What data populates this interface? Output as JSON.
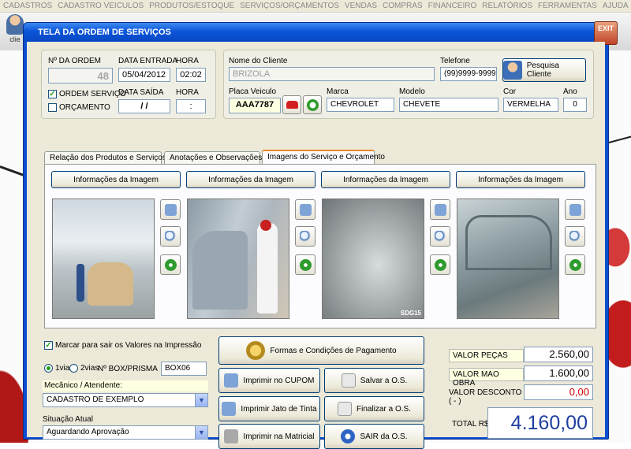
{
  "menu": [
    "CADASTROS",
    "CADASTRO VEICULOS",
    "PRODUTOS/ESTOQUE",
    "SERVIÇOS/ORÇAMENTOS",
    "VENDAS",
    "COMPRAS",
    "FINANCEIRO",
    "RELATÓRIOS",
    "FERRAMENTAS",
    "AJUDA"
  ],
  "toolbar": {
    "left_label": "clie"
  },
  "window": {
    "title": "TELA DA ORDEM DE SERVIÇOS",
    "exit_label": "EXIT"
  },
  "order": {
    "num_label": "Nº DA ORDEM",
    "num_value": "48",
    "entry_label": "DATA ENTRADA",
    "entry_date": "05/04/2012",
    "hour_label": "HORA",
    "entry_hour": "02:02",
    "exit_label": "DATA SAÍDA",
    "exit_date": " / / ",
    "exit_hour_label": "HORA",
    "exit_hour": ":",
    "chk_os": "ORDEM SERVIÇO",
    "chk_orc": "ORÇAMENTO"
  },
  "client": {
    "name_label": "Nome do Cliente",
    "name": "BRIZOLA",
    "phone_label": "Telefone",
    "phone": "(99)9999-9999",
    "search_button": "Pesquisa Cliente",
    "plate_label": "Placa Veiculo",
    "plate": "AAA7787",
    "brand_label": "Marca",
    "brand": "CHEVROLET",
    "model_label": "Modelo",
    "model": "CHEVETE",
    "color_label": "Cor",
    "color": "VERMELHA",
    "year_label": "Ano",
    "year": "0"
  },
  "tabs": [
    "Relação dos Produtos e Serviços ->",
    "Anotações e Observações ->",
    "Imagens do Serviço e Orçamento"
  ],
  "images": {
    "info_label": "Informações da Imagem",
    "watermark": "SDG15"
  },
  "print_options": {
    "mark_values": "Marcar para sair os Valores na Impressão",
    "via1": "1via",
    "via2": "2vias",
    "box_label": "Nº BOX/PRISMA",
    "box_value": "BOX06",
    "mechanic_label": "Mecânico / Atendente:",
    "mechanic": "CADASTRO DE EXEMPLO",
    "status_label": "Situação Atual",
    "status": "Aguardando Aprovação"
  },
  "actions": {
    "payment": "Formas e Condições de Pagamento",
    "print_cupom": "Imprimir no CUPOM",
    "print_inkjet": "Imprimir Jato de Tinta",
    "print_matrix": "Imprimir na Matricial",
    "save": "Salvar a O.S.",
    "finalize": "Finalizar a O.S.",
    "exit": "SAIR da O.S."
  },
  "totals": {
    "parts_label": "VALOR PEÇAS",
    "parts": "2.560,00",
    "labor_label": "VALOR MAO OBRA",
    "labor": "1.600,00",
    "discount_label": "VALOR DESCONTO ( - )",
    "discount": "0,00",
    "total_label": "TOTAL R$",
    "total": "4.160,00"
  },
  "colors": {
    "title_blue": "#0b55d8",
    "total_blue": "#1f3fa0",
    "discount_red": "#cc0000",
    "tab_accent": "#e68b2c"
  }
}
